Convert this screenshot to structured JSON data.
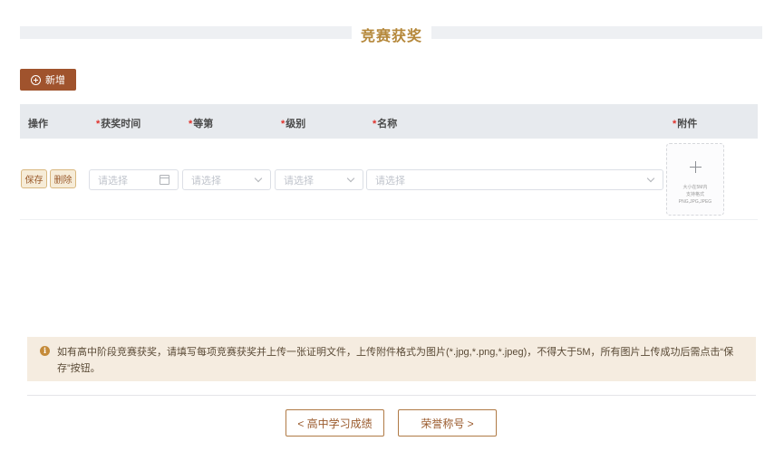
{
  "section": {
    "title": "竞赛获奖"
  },
  "toolbar": {
    "add_label": "新增"
  },
  "table": {
    "headers": [
      {
        "label": "操作",
        "required": false
      },
      {
        "label": "获奖时间",
        "required": true
      },
      {
        "label": "等第",
        "required": true
      },
      {
        "label": "级别",
        "required": true
      },
      {
        "label": "名称",
        "required": true
      },
      {
        "label": "附件",
        "required": true
      }
    ],
    "required_mark": "*",
    "row": {
      "save_label": "保存",
      "delete_label": "删除",
      "date_placeholder": "请选择",
      "grade_placeholder": "请选择",
      "level_placeholder": "请选择",
      "name_placeholder": "请选择",
      "upload_hint_1": "大小在5M内",
      "upload_hint_2": "支持格式",
      "upload_hint_3": "PNG,JPG,JPEG"
    }
  },
  "notice": {
    "icon": "info-icon",
    "text": "如有高中阶段竞赛获奖，请填写每项竞赛获奖并上传一张证明文件，上传附件格式为图片(*.jpg,*.png,*.jpeg)，不得大于5M，所有图片上传成功后需点击“保存”按钮。"
  },
  "nav": {
    "prev_label": "< 高中学习成绩",
    "next_label": "荣誉称号 >"
  },
  "colors": {
    "accent": "#a0532d",
    "title": "#b5883b",
    "required": "#e0312b",
    "notice_bg": "#f5ece0"
  }
}
